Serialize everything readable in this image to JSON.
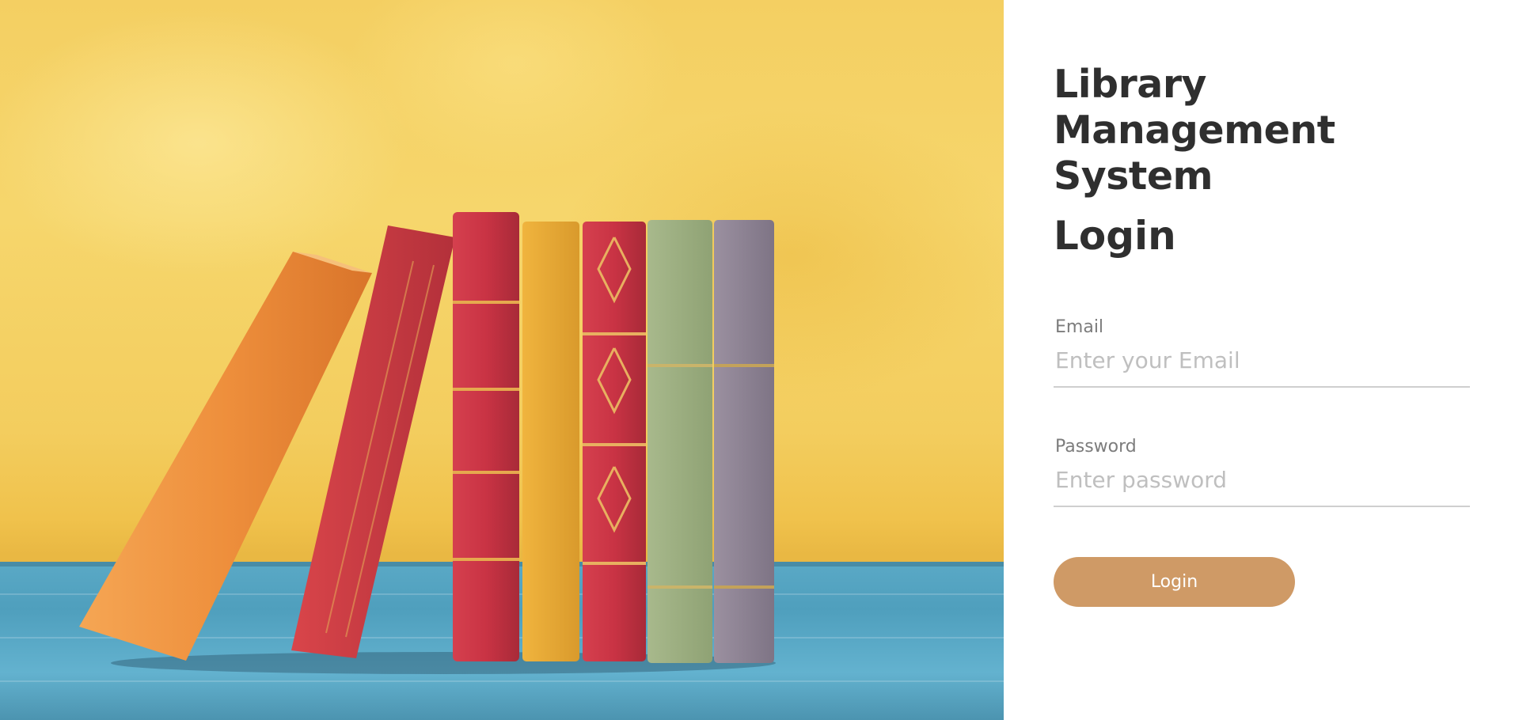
{
  "hero": {
    "image_alt": "Row of old books on a blue wooden table against a yellow wall"
  },
  "app": {
    "title": "Library Management System"
  },
  "login": {
    "heading": "Login",
    "email": {
      "label": "Email",
      "placeholder": "Enter your Email",
      "value": ""
    },
    "password": {
      "label": "Password",
      "placeholder": "Enter password",
      "value": ""
    },
    "button_label": "Login"
  },
  "colors": {
    "accent": "#cf9a66",
    "text_dark": "#2f2f2f",
    "label_gray": "#7c7c7c",
    "placeholder_gray": "#bfbfbf",
    "wall_yellow": "#f4cf62",
    "table_blue": "#5aa9c6"
  }
}
